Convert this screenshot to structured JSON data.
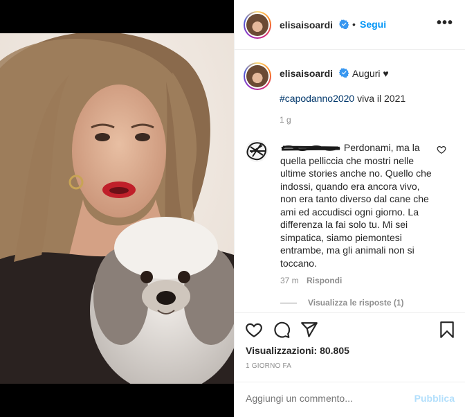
{
  "post": {
    "username": "elisaisoardi",
    "follow_label": "Segui",
    "dot": "•",
    "more_label": "•••"
  },
  "caption": {
    "username": "elisaisoardi",
    "text": "Auguri ♥",
    "hashtag": "#capodanno2020",
    "rest": " viva il 2021",
    "age": "1 g"
  },
  "comment": {
    "text": "Perdonami, ma la quella pelliccia che mostri nelle ultime stories anche no. Quello che indossi, quando era ancora vivo, non era tanto diverso dal cane che ami ed accudisci ogni giorno. La differenza la fai solo tu. Mi sei simpatica, siamo piemontesi entrambe, ma gli animali non si toccano.",
    "age": "37 m",
    "reply_label": "Rispondi",
    "view_replies": "Visualizza le risposte (1)"
  },
  "stats": {
    "views_label": "Visualizzazioni: 80.805",
    "posted": "1 GIORNO FA"
  },
  "composer": {
    "placeholder": "Aggiungi un commento...",
    "publish_label": "Pubblica"
  },
  "icons": {
    "like": "heart-icon",
    "comment": "comment-icon",
    "share": "share-icon",
    "save": "bookmark-icon",
    "verified": "verified-badge-icon",
    "more": "more-options-icon"
  },
  "colors": {
    "accent": "#0095f6",
    "hashtag": "#00376b",
    "muted": "#8e8e8e",
    "publish_disabled": "#b2dffc"
  }
}
